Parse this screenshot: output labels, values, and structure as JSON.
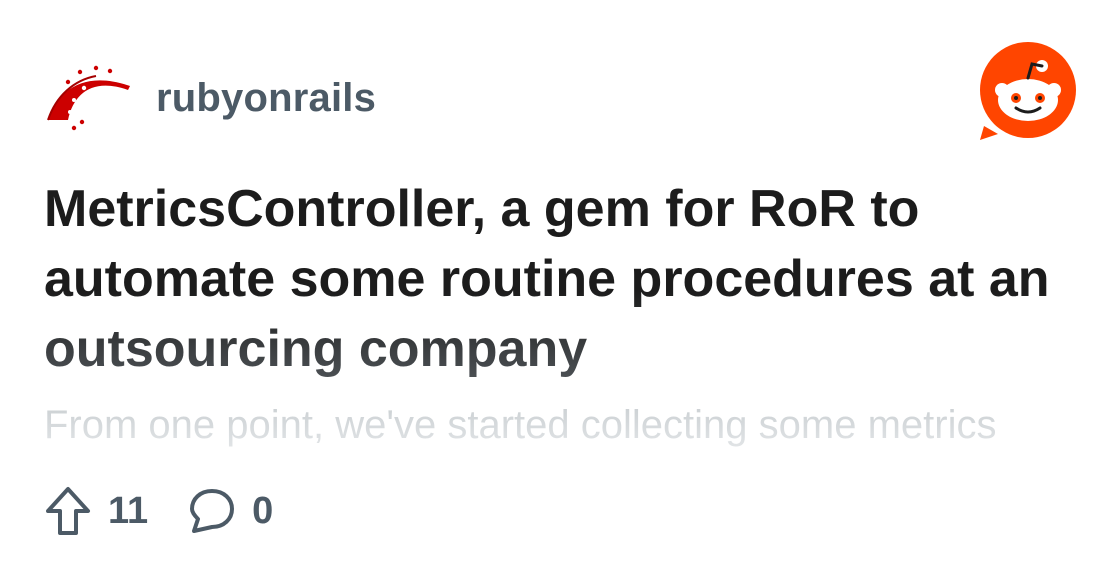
{
  "subreddit": {
    "name": "rubyonrails",
    "logo_icon": "rails-logo-icon"
  },
  "post": {
    "title": "MetricsController, a gem for RoR to automate some routine procedures at an outsourcing company",
    "preview_text": "From one point, we've started collecting some metrics"
  },
  "stats": {
    "upvotes": "11",
    "comments": "0",
    "upvote_icon": "upvote-arrow-icon",
    "comment_icon": "comment-bubble-icon"
  },
  "brand": {
    "logo_icon": "reddit-logo-icon",
    "accent_color": "#ff4500",
    "rails_color": "#cc0000"
  }
}
